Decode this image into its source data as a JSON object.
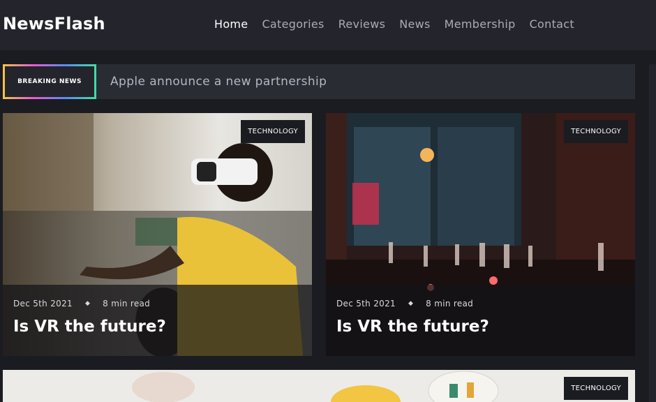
{
  "header": {
    "logo": "NewsFlash",
    "nav": [
      "Home",
      "Categories",
      "Reviews",
      "News",
      "Membership",
      "Contact"
    ]
  },
  "breaking": {
    "badge": "BREAKING NEWS",
    "headline": "Apple announce a new partnership"
  },
  "cards": [
    {
      "category": "TECHNOLOGY",
      "date": "Dec 5th 2021",
      "separator": "◆",
      "read_time": "8 min read",
      "title": "Is VR the future?"
    },
    {
      "category": "TECHNOLOGY",
      "date": "Dec 5th 2021",
      "separator": "◆",
      "read_time": "8 min read",
      "title": "Is VR the future?"
    },
    {
      "category": "TECHNOLOGY"
    }
  ],
  "colors": {
    "background": "#1b1c21",
    "header": "#24252c",
    "accent_text": "#ffffff"
  }
}
